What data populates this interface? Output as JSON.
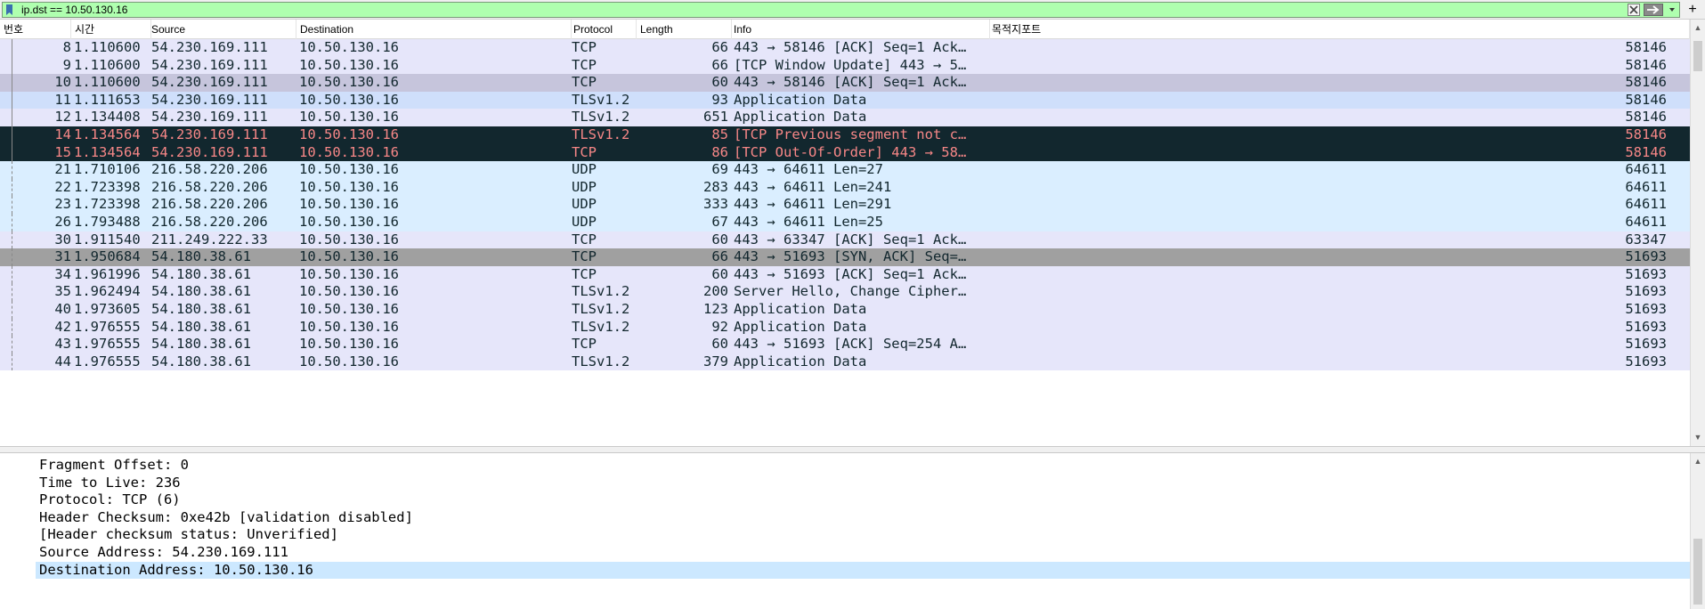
{
  "filter": {
    "value": "ip.dst == 10.50.130.16",
    "add_label": "+"
  },
  "columns": [
    "번호",
    "시간",
    "Source",
    "Destination",
    "Protocol",
    "Length",
    "Info",
    "목적지포트"
  ],
  "packets": [
    {
      "no": "8",
      "time": "1.110600",
      "src": "54.230.169.111",
      "dst": "10.50.130.16",
      "proto": "TCP",
      "len": "66",
      "info": "443 → 58146 [ACK] Seq=1 Ack…",
      "port": "58146",
      "bg": "#e6e6fa",
      "fg": "#12272e"
    },
    {
      "no": "9",
      "time": "1.110600",
      "src": "54.230.169.111",
      "dst": "10.50.130.16",
      "proto": "TCP",
      "len": "66",
      "info": "[TCP Window Update] 443 → 5…",
      "port": "58146",
      "bg": "#e6e6fa",
      "fg": "#12272e"
    },
    {
      "no": "10",
      "time": "1.110600",
      "src": "54.230.169.111",
      "dst": "10.50.130.16",
      "proto": "TCP",
      "len": "60",
      "info": "443 → 58146 [ACK] Seq=1 Ack…",
      "port": "58146",
      "bg": "#c6c5dc",
      "fg": "#12272e"
    },
    {
      "no": "11",
      "time": "1.111653",
      "src": "54.230.169.111",
      "dst": "10.50.130.16",
      "proto": "TLSv1.2",
      "len": "93",
      "info": "Application Data",
      "port": "58146",
      "bg": "#cfdffb",
      "fg": "#12272e"
    },
    {
      "no": "12",
      "time": "1.134408",
      "src": "54.230.169.111",
      "dst": "10.50.130.16",
      "proto": "TLSv1.2",
      "len": "651",
      "info": "Application Data",
      "port": "58146",
      "bg": "#e6e6fa",
      "fg": "#12272e"
    },
    {
      "no": "14",
      "time": "1.134564",
      "src": "54.230.169.111",
      "dst": "10.50.130.16",
      "proto": "TLSv1.2",
      "len": "85",
      "info": "[TCP Previous segment not c…",
      "port": "58146",
      "bg": "#12272e",
      "fg": "#f78787"
    },
    {
      "no": "15",
      "time": "1.134564",
      "src": "54.230.169.111",
      "dst": "10.50.130.16",
      "proto": "TCP",
      "len": "86",
      "info": "[TCP Out-Of-Order] 443 → 58…",
      "port": "58146",
      "bg": "#12272e",
      "fg": "#f78787"
    },
    {
      "no": "21",
      "time": "1.710106",
      "src": "216.58.220.206",
      "dst": "10.50.130.16",
      "proto": "UDP",
      "len": "69",
      "info": "443 → 64611 Len=27",
      "port": "64611",
      "bg": "#daeeff",
      "fg": "#12272e"
    },
    {
      "no": "22",
      "time": "1.723398",
      "src": "216.58.220.206",
      "dst": "10.50.130.16",
      "proto": "UDP",
      "len": "283",
      "info": "443 → 64611 Len=241",
      "port": "64611",
      "bg": "#daeeff",
      "fg": "#12272e"
    },
    {
      "no": "23",
      "time": "1.723398",
      "src": "216.58.220.206",
      "dst": "10.50.130.16",
      "proto": "UDP",
      "len": "333",
      "info": "443 → 64611 Len=291",
      "port": "64611",
      "bg": "#daeeff",
      "fg": "#12272e"
    },
    {
      "no": "26",
      "time": "1.793488",
      "src": "216.58.220.206",
      "dst": "10.50.130.16",
      "proto": "UDP",
      "len": "67",
      "info": "443 → 64611 Len=25",
      "port": "64611",
      "bg": "#daeeff",
      "fg": "#12272e"
    },
    {
      "no": "30",
      "time": "1.911540",
      "src": "211.249.222.33",
      "dst": "10.50.130.16",
      "proto": "TCP",
      "len": "60",
      "info": "443 → 63347 [ACK] Seq=1 Ack…",
      "port": "63347",
      "bg": "#e6e6fa",
      "fg": "#12272e"
    },
    {
      "no": "31",
      "time": "1.950684",
      "src": "54.180.38.61",
      "dst": "10.50.130.16",
      "proto": "TCP",
      "len": "66",
      "info": "443 → 51693 [SYN, ACK] Seq=…",
      "port": "51693",
      "bg": "#a0a0a0",
      "fg": "#12272e"
    },
    {
      "no": "34",
      "time": "1.961996",
      "src": "54.180.38.61",
      "dst": "10.50.130.16",
      "proto": "TCP",
      "len": "60",
      "info": "443 → 51693 [ACK] Seq=1 Ack…",
      "port": "51693",
      "bg": "#e6e6fa",
      "fg": "#12272e"
    },
    {
      "no": "35",
      "time": "1.962494",
      "src": "54.180.38.61",
      "dst": "10.50.130.16",
      "proto": "TLSv1.2",
      "len": "200",
      "info": "Server Hello, Change Cipher…",
      "port": "51693",
      "bg": "#e6e6fa",
      "fg": "#12272e"
    },
    {
      "no": "40",
      "time": "1.973605",
      "src": "54.180.38.61",
      "dst": "10.50.130.16",
      "proto": "TLSv1.2",
      "len": "123",
      "info": "Application Data",
      "port": "51693",
      "bg": "#e6e6fa",
      "fg": "#12272e"
    },
    {
      "no": "42",
      "time": "1.976555",
      "src": "54.180.38.61",
      "dst": "10.50.130.16",
      "proto": "TLSv1.2",
      "len": "92",
      "info": "Application Data",
      "port": "51693",
      "bg": "#e6e6fa",
      "fg": "#12272e"
    },
    {
      "no": "43",
      "time": "1.976555",
      "src": "54.180.38.61",
      "dst": "10.50.130.16",
      "proto": "TCP",
      "len": "60",
      "info": "443 → 51693 [ACK] Seq=254 A…",
      "port": "51693",
      "bg": "#e6e6fa",
      "fg": "#12272e"
    },
    {
      "no": "44",
      "time": "1.976555",
      "src": "54.180.38.61",
      "dst": "10.50.130.16",
      "proto": "TLSv1.2",
      "len": "379",
      "info": "Application Data",
      "port": "51693",
      "bg": "#e6e6fa",
      "fg": "#12272e"
    }
  ],
  "details": [
    {
      "text": "Fragment Offset: 0",
      "selected": false
    },
    {
      "text": "Time to Live: 236",
      "selected": false
    },
    {
      "text": "Protocol: TCP (6)",
      "selected": false
    },
    {
      "text": "Header Checksum: 0xe42b [validation disabled]",
      "selected": false
    },
    {
      "text": "[Header checksum status: Unverified]",
      "selected": false
    },
    {
      "text": "Source Address: 54.230.169.111",
      "selected": false
    },
    {
      "text": "Destination Address: 10.50.130.16",
      "selected": true
    }
  ],
  "colors": {
    "filter_valid": "#afffaf",
    "selection": "#cce8ff"
  }
}
